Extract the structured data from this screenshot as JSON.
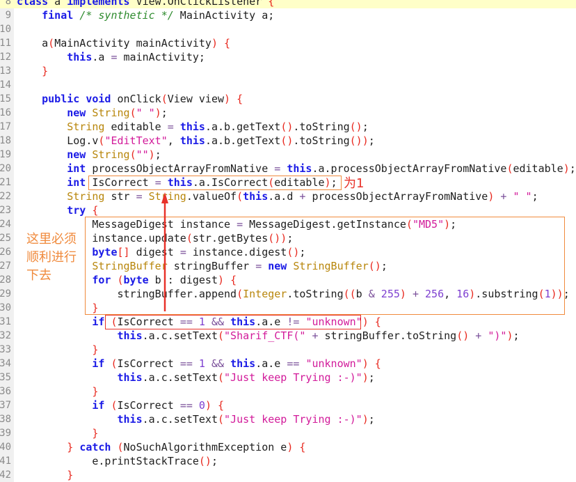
{
  "editor": {
    "current_line": "8",
    "lines": [
      {
        "n": "8",
        "t": [
          [
            "k",
            "class"
          ],
          [
            "x",
            " a "
          ],
          [
            "k",
            "implements"
          ],
          [
            "x",
            " View.OnClickListener "
          ],
          [
            "p",
            "{"
          ]
        ]
      },
      {
        "n": "9",
        "t": [
          [
            "x",
            "    "
          ],
          [
            "k",
            "final"
          ],
          [
            "x",
            " "
          ],
          [
            "c",
            "/* synthetic */"
          ],
          [
            "x",
            " MainActivity a;"
          ]
        ]
      },
      {
        "n": "10",
        "t": []
      },
      {
        "n": "11",
        "t": [
          [
            "x",
            "    a"
          ],
          [
            "p",
            "("
          ],
          [
            "x",
            "MainActivity mainActivity"
          ],
          [
            "p",
            ")"
          ],
          [
            "x",
            " "
          ],
          [
            "p",
            "{"
          ]
        ]
      },
      {
        "n": "12",
        "t": [
          [
            "x",
            "        "
          ],
          [
            "k",
            "this"
          ],
          [
            "x",
            ".a "
          ],
          [
            "o",
            "="
          ],
          [
            "x",
            " mainActivity;"
          ]
        ]
      },
      {
        "n": "13",
        "t": [
          [
            "x",
            "    "
          ],
          [
            "p",
            "}"
          ]
        ]
      },
      {
        "n": "14",
        "t": []
      },
      {
        "n": "15",
        "t": [
          [
            "x",
            "    "
          ],
          [
            "k",
            "public"
          ],
          [
            "x",
            " "
          ],
          [
            "k",
            "void"
          ],
          [
            "x",
            " onClick"
          ],
          [
            "p",
            "("
          ],
          [
            "x",
            "View view"
          ],
          [
            "p",
            ")"
          ],
          [
            "x",
            " "
          ],
          [
            "p",
            "{"
          ]
        ]
      },
      {
        "n": "16",
        "t": [
          [
            "x",
            "        "
          ],
          [
            "k",
            "new"
          ],
          [
            "x",
            " "
          ],
          [
            "t",
            "String"
          ],
          [
            "p",
            "("
          ],
          [
            "s",
            "\" \""
          ],
          [
            "p",
            ")"
          ],
          [
            "x",
            ";"
          ]
        ]
      },
      {
        "n": "17",
        "t": [
          [
            "x",
            "        "
          ],
          [
            "t",
            "String"
          ],
          [
            "x",
            " editable "
          ],
          [
            "o",
            "="
          ],
          [
            "x",
            " "
          ],
          [
            "k",
            "this"
          ],
          [
            "x",
            ".a.b.getText"
          ],
          [
            "p",
            "()"
          ],
          [
            "x",
            ".toString"
          ],
          [
            "p",
            "()"
          ],
          [
            "x",
            ";"
          ]
        ]
      },
      {
        "n": "18",
        "t": [
          [
            "x",
            "        Log.v"
          ],
          [
            "p",
            "("
          ],
          [
            "s",
            "\"EditText\""
          ],
          [
            "x",
            ", "
          ],
          [
            "k",
            "this"
          ],
          [
            "x",
            ".a.b.getText"
          ],
          [
            "p",
            "()"
          ],
          [
            "x",
            ".toString"
          ],
          [
            "p",
            "())"
          ],
          [
            "x",
            ";"
          ]
        ]
      },
      {
        "n": "19",
        "t": [
          [
            "x",
            "        "
          ],
          [
            "k",
            "new"
          ],
          [
            "x",
            " "
          ],
          [
            "t",
            "String"
          ],
          [
            "p",
            "("
          ],
          [
            "s",
            "\"\""
          ],
          [
            "p",
            ")"
          ],
          [
            "x",
            ";"
          ]
        ]
      },
      {
        "n": "20",
        "t": [
          [
            "x",
            "        "
          ],
          [
            "k",
            "int"
          ],
          [
            "x",
            " processObjectArrayFromNative "
          ],
          [
            "o",
            "="
          ],
          [
            "x",
            " "
          ],
          [
            "k",
            "this"
          ],
          [
            "x",
            ".a.processObjectArrayFromNative"
          ],
          [
            "p",
            "("
          ],
          [
            "x",
            "editable"
          ],
          [
            "p",
            ")"
          ],
          [
            "x",
            ";"
          ]
        ]
      },
      {
        "n": "21",
        "t": [
          [
            "x",
            "        "
          ],
          [
            "k",
            "int"
          ],
          [
            "x",
            " IsCorrect "
          ],
          [
            "o",
            "="
          ],
          [
            "x",
            " "
          ],
          [
            "k",
            "this"
          ],
          [
            "x",
            ".a.IsCorrect"
          ],
          [
            "p",
            "("
          ],
          [
            "x",
            "editable"
          ],
          [
            "p",
            ")"
          ],
          [
            "x",
            ";"
          ]
        ]
      },
      {
        "n": "22",
        "t": [
          [
            "x",
            "        "
          ],
          [
            "t",
            "String"
          ],
          [
            "x",
            " str "
          ],
          [
            "o",
            "="
          ],
          [
            "x",
            " "
          ],
          [
            "t",
            "String"
          ],
          [
            "x",
            ".valueOf"
          ],
          [
            "p",
            "("
          ],
          [
            "k",
            "this"
          ],
          [
            "x",
            ".a.d "
          ],
          [
            "o",
            "+"
          ],
          [
            "x",
            " processObjectArrayFromNative"
          ],
          [
            "p",
            ")"
          ],
          [
            "x",
            " "
          ],
          [
            "o",
            "+"
          ],
          [
            "x",
            " "
          ],
          [
            "s",
            "\" \""
          ],
          [
            "x",
            ";"
          ]
        ]
      },
      {
        "n": "23",
        "t": [
          [
            "x",
            "        "
          ],
          [
            "k",
            "try"
          ],
          [
            "x",
            " "
          ],
          [
            "p",
            "{"
          ]
        ]
      },
      {
        "n": "24",
        "t": [
          [
            "x",
            "            MessageDigest instance "
          ],
          [
            "o",
            "="
          ],
          [
            "x",
            " MessageDigest.getInstance"
          ],
          [
            "p",
            "("
          ],
          [
            "s",
            "\"MD5\""
          ],
          [
            "p",
            ")"
          ],
          [
            "x",
            ";"
          ]
        ]
      },
      {
        "n": "25",
        "t": [
          [
            "x",
            "            instance.update"
          ],
          [
            "p",
            "("
          ],
          [
            "x",
            "str.getBytes"
          ],
          [
            "p",
            "())"
          ],
          [
            "x",
            ";"
          ]
        ]
      },
      {
        "n": "26",
        "t": [
          [
            "x",
            "            "
          ],
          [
            "k",
            "byte"
          ],
          [
            "p",
            "[]"
          ],
          [
            "x",
            " digest "
          ],
          [
            "o",
            "="
          ],
          [
            "x",
            " instance.digest"
          ],
          [
            "p",
            "()"
          ],
          [
            "x",
            ";"
          ]
        ]
      },
      {
        "n": "27",
        "t": [
          [
            "x",
            "            "
          ],
          [
            "t",
            "StringBuffer"
          ],
          [
            "x",
            " stringBuffer "
          ],
          [
            "o",
            "="
          ],
          [
            "x",
            " "
          ],
          [
            "k",
            "new"
          ],
          [
            "x",
            " "
          ],
          [
            "t",
            "StringBuffer"
          ],
          [
            "p",
            "()"
          ],
          [
            "x",
            ";"
          ]
        ]
      },
      {
        "n": "28",
        "t": [
          [
            "x",
            "            "
          ],
          [
            "k",
            "for"
          ],
          [
            "x",
            " "
          ],
          [
            "p",
            "("
          ],
          [
            "k",
            "byte"
          ],
          [
            "x",
            " b : digest"
          ],
          [
            "p",
            ")"
          ],
          [
            "x",
            " "
          ],
          [
            "p",
            "{"
          ]
        ]
      },
      {
        "n": "29",
        "t": [
          [
            "x",
            "                stringBuffer.append"
          ],
          [
            "p",
            "("
          ],
          [
            "t",
            "Integer"
          ],
          [
            "x",
            ".toString"
          ],
          [
            "p",
            "(("
          ],
          [
            "x",
            "b "
          ],
          [
            "o",
            "&"
          ],
          [
            "x",
            " "
          ],
          [
            "n",
            "255"
          ],
          [
            "p",
            ")"
          ],
          [
            "x",
            " "
          ],
          [
            "o",
            "+"
          ],
          [
            "x",
            " "
          ],
          [
            "n",
            "256"
          ],
          [
            "x",
            ", "
          ],
          [
            "n",
            "16"
          ],
          [
            "p",
            ")"
          ],
          [
            "x",
            ".substring"
          ],
          [
            "p",
            "("
          ],
          [
            "n",
            "1"
          ],
          [
            "p",
            "))"
          ],
          [
            "x",
            ";"
          ]
        ]
      },
      {
        "n": "30",
        "t": [
          [
            "x",
            "            "
          ],
          [
            "p",
            "}"
          ]
        ]
      },
      {
        "n": "31",
        "t": [
          [
            "x",
            "            "
          ],
          [
            "k",
            "if"
          ],
          [
            "x",
            " "
          ],
          [
            "p",
            "("
          ],
          [
            "x",
            "IsCorrect "
          ],
          [
            "o",
            "=="
          ],
          [
            "x",
            " "
          ],
          [
            "n",
            "1"
          ],
          [
            "x",
            " "
          ],
          [
            "o",
            "&&"
          ],
          [
            "x",
            " "
          ],
          [
            "k",
            "this"
          ],
          [
            "x",
            ".a.e "
          ],
          [
            "o",
            "!="
          ],
          [
            "x",
            " "
          ],
          [
            "s",
            "\"unknown\""
          ],
          [
            "p",
            ")"
          ],
          [
            "x",
            " "
          ],
          [
            "p",
            "{"
          ]
        ]
      },
      {
        "n": "32",
        "t": [
          [
            "x",
            "                "
          ],
          [
            "k",
            "this"
          ],
          [
            "x",
            ".a.c.setText"
          ],
          [
            "p",
            "("
          ],
          [
            "s",
            "\"Sharif_CTF(\""
          ],
          [
            "x",
            " "
          ],
          [
            "o",
            "+"
          ],
          [
            "x",
            " stringBuffer.toString"
          ],
          [
            "p",
            "()"
          ],
          [
            "x",
            " "
          ],
          [
            "o",
            "+"
          ],
          [
            "x",
            " "
          ],
          [
            "s",
            "\")\""
          ],
          [
            "p",
            ")"
          ],
          [
            "x",
            ";"
          ]
        ]
      },
      {
        "n": "33",
        "t": [
          [
            "x",
            "            "
          ],
          [
            "p",
            "}"
          ]
        ]
      },
      {
        "n": "34",
        "t": [
          [
            "x",
            "            "
          ],
          [
            "k",
            "if"
          ],
          [
            "x",
            " "
          ],
          [
            "p",
            "("
          ],
          [
            "x",
            "IsCorrect "
          ],
          [
            "o",
            "=="
          ],
          [
            "x",
            " "
          ],
          [
            "n",
            "1"
          ],
          [
            "x",
            " "
          ],
          [
            "o",
            "&&"
          ],
          [
            "x",
            " "
          ],
          [
            "k",
            "this"
          ],
          [
            "x",
            ".a.e "
          ],
          [
            "o",
            "=="
          ],
          [
            "x",
            " "
          ],
          [
            "s",
            "\"unknown\""
          ],
          [
            "p",
            ")"
          ],
          [
            "x",
            " "
          ],
          [
            "p",
            "{"
          ]
        ]
      },
      {
        "n": "35",
        "t": [
          [
            "x",
            "                "
          ],
          [
            "k",
            "this"
          ],
          [
            "x",
            ".a.c.setText"
          ],
          [
            "p",
            "("
          ],
          [
            "s",
            "\"Just keep Trying :-)\""
          ],
          [
            "p",
            ")"
          ],
          [
            "x",
            ";"
          ]
        ]
      },
      {
        "n": "36",
        "t": [
          [
            "x",
            "            "
          ],
          [
            "p",
            "}"
          ]
        ]
      },
      {
        "n": "37",
        "t": [
          [
            "x",
            "            "
          ],
          [
            "k",
            "if"
          ],
          [
            "x",
            " "
          ],
          [
            "p",
            "("
          ],
          [
            "x",
            "IsCorrect "
          ],
          [
            "o",
            "=="
          ],
          [
            "x",
            " "
          ],
          [
            "n",
            "0"
          ],
          [
            "p",
            ")"
          ],
          [
            "x",
            " "
          ],
          [
            "p",
            "{"
          ]
        ]
      },
      {
        "n": "38",
        "t": [
          [
            "x",
            "                "
          ],
          [
            "k",
            "this"
          ],
          [
            "x",
            ".a.c.setText"
          ],
          [
            "p",
            "("
          ],
          [
            "s",
            "\"Just keep Trying :-)\""
          ],
          [
            "p",
            ")"
          ],
          [
            "x",
            ";"
          ]
        ]
      },
      {
        "n": "39",
        "t": [
          [
            "x",
            "            "
          ],
          [
            "p",
            "}"
          ]
        ]
      },
      {
        "n": "40",
        "t": [
          [
            "x",
            "        "
          ],
          [
            "p",
            "}"
          ],
          [
            "x",
            " "
          ],
          [
            "k",
            "catch"
          ],
          [
            "x",
            " "
          ],
          [
            "p",
            "("
          ],
          [
            "x",
            "NoSuchAlgorithmException e"
          ],
          [
            "p",
            ")"
          ],
          [
            "x",
            " "
          ],
          [
            "p",
            "{"
          ]
        ]
      },
      {
        "n": "41",
        "t": [
          [
            "x",
            "            e.printStackTrace"
          ],
          [
            "p",
            "()"
          ],
          [
            "x",
            ";"
          ]
        ]
      },
      {
        "n": "42",
        "t": [
          [
            "x",
            "        "
          ],
          [
            "p",
            "}"
          ]
        ]
      }
    ]
  },
  "annotations": {
    "result_note": "为1",
    "side_note": [
      "这里必须",
      "顺利进行",
      "下去"
    ],
    "colors": {
      "orange": "#f08a3c",
      "red": "#e8322a"
    }
  }
}
